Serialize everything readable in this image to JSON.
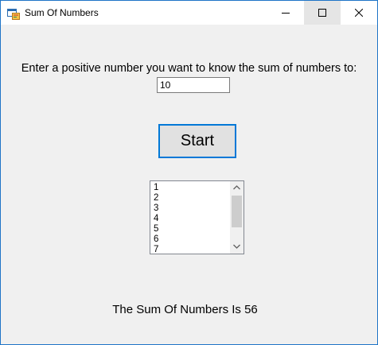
{
  "window": {
    "title": "Sum Of Numbers",
    "controls": {
      "minimize": "minimize",
      "maximize": "maximize",
      "close": "close"
    }
  },
  "form": {
    "prompt": "Enter a positive number you want to know the sum of numbers to:",
    "input_value": "10",
    "start_label": "Start"
  },
  "list": {
    "items": [
      "1",
      "2",
      "3",
      "4",
      "5",
      "6",
      "7"
    ]
  },
  "result": {
    "text": "The Sum Of Numbers Is 56"
  },
  "colors": {
    "accent": "#0078d7",
    "window_border": "#1e74c7",
    "background": "#f0f0f0"
  },
  "icons": [
    "app-form-icon",
    "minimize-icon",
    "maximize-icon",
    "close-icon",
    "scroll-up-arrow-icon",
    "scroll-down-arrow-icon"
  ]
}
